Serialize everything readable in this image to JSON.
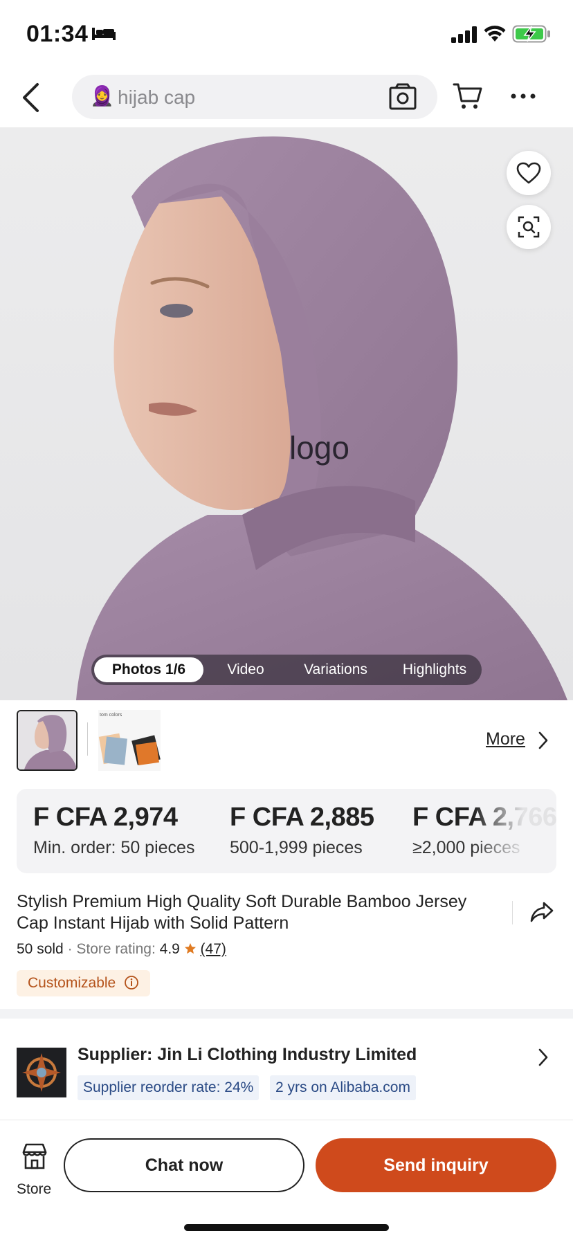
{
  "status_bar": {
    "time": "01:34",
    "icons": [
      "sleep-mode-icon",
      "signal-icon",
      "wifi-icon",
      "battery-charging-icon"
    ]
  },
  "nav": {
    "back_icon": "chevron-left-icon",
    "search": {
      "emoji": "🧕",
      "value": "hijab cap"
    },
    "icons": [
      "camera-search-icon",
      "cart-icon",
      "more-options-icon"
    ]
  },
  "gallery": {
    "image_text": "logo",
    "tabs": [
      {
        "label": "Photos 1/6",
        "active": true
      },
      {
        "label": "Video"
      },
      {
        "label": "Variations"
      },
      {
        "label": "Highlights"
      }
    ],
    "thumbnail_text": "tom colors",
    "more_label": "More"
  },
  "pricing": [
    {
      "price": "F CFA 2,974",
      "qty": "Min. order: 50 pieces"
    },
    {
      "price": "F CFA 2,885",
      "qty": "500-1,999 pieces"
    },
    {
      "price": "F CFA 2,766",
      "qty": "≥2,000 pieces"
    }
  ],
  "product": {
    "title": "Stylish Premium High Quality Soft Durable Bamboo Jersey Cap Instant Hijab with Solid Pattern",
    "sold": "50 sold",
    "separator": "·",
    "store_rating_label": "Store rating:",
    "rating": "4.9",
    "reviews": "(47)",
    "badge": "Customizable"
  },
  "supplier": {
    "label": "Supplier:",
    "name": "Jin Li Clothing Industry Limited",
    "reorder_rate": "Supplier reorder rate: 24%",
    "years": "2 yrs on Alibaba.com"
  },
  "bottom_bar": {
    "store_label": "Store",
    "chat_label": "Chat now",
    "inquiry_label": "Send inquiry"
  },
  "colors": {
    "accent": "#cf4a1c",
    "hijab": "#9d819d",
    "badge_bg": "#fdf1e4",
    "chip_bg": "#eef2f9"
  }
}
